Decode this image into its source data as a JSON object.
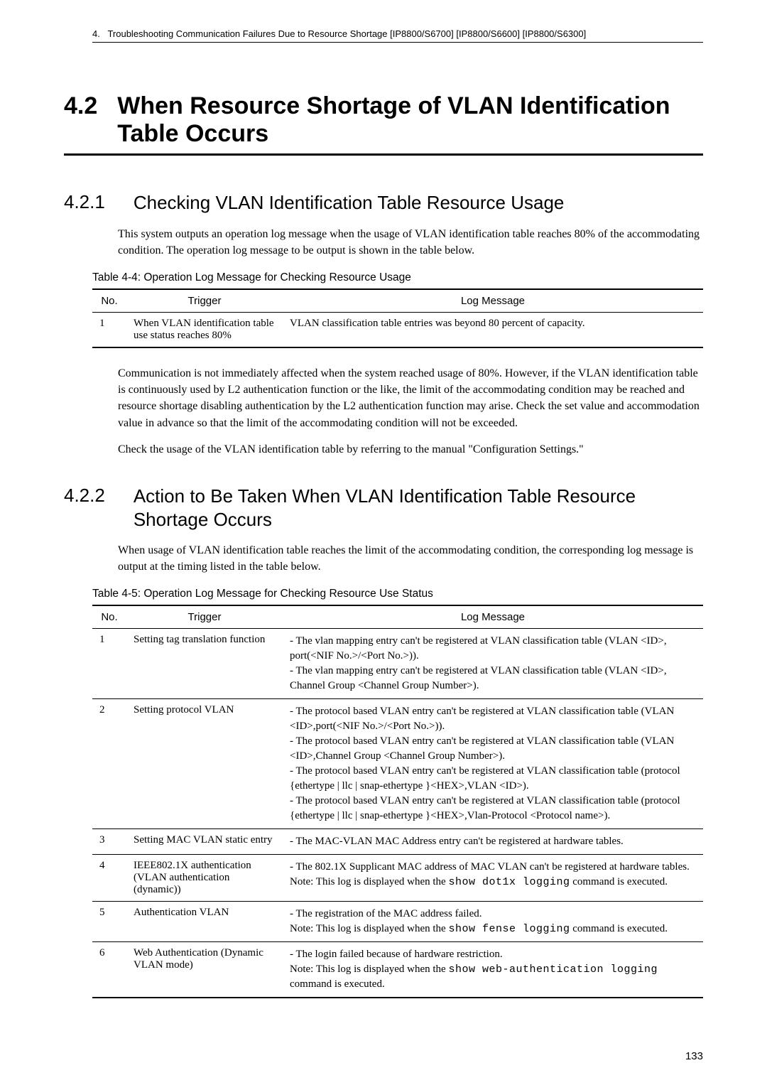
{
  "header": {
    "chapter_num": "4.",
    "chapter_title": "Troubleshooting Communication Failures Due to Resource Shortage [IP8800/S6700] [IP8800/S6600] [IP8800/S6300]"
  },
  "section": {
    "num": "4.2",
    "title": "When Resource Shortage of VLAN Identification Table Occurs"
  },
  "sub1": {
    "num": "4.2.1",
    "title": "Checking VLAN Identification Table Resource Usage",
    "para1": "This system outputs an operation log message when the usage of VLAN identification table reaches 80% of the accommodating condition. The operation log message to be output is shown in the table below.",
    "para2": "Communication is not immediately affected when the system reached usage of 80%. However, if the VLAN identification table is continuously used by L2 authentication function or the like, the limit of the accommodating condition may be reached and resource shortage disabling authentication by the L2 authentication function may arise. Check the set value and accommodation value in advance so that the limit of the accommodating condition will not be exceeded.",
    "para3": "Check the usage of the VLAN identification table by referring to the manual \"Configuration Settings.\""
  },
  "table44": {
    "caption": "Table 4-4: Operation Log Message for Checking Resource Usage",
    "headers": {
      "no": "No.",
      "trigger": "Trigger",
      "log": "Log Message"
    },
    "rows": [
      {
        "no": "1",
        "trigger": "When VLAN identification table use status reaches 80%",
        "log": "VLAN classification table entries was beyond 80 percent of capacity."
      }
    ]
  },
  "sub2": {
    "num": "4.2.2",
    "title": "Action to Be Taken When VLAN Identification Table Resource Shortage Occurs",
    "para1": "When usage of VLAN identification table reaches the limit of the accommodating condition, the corresponding log message is output at the timing listed in the table below."
  },
  "table45": {
    "caption": "Table 4-5: Operation Log Message for Checking Resource Use Status",
    "headers": {
      "no": "No.",
      "trigger": "Trigger",
      "log": "Log Message"
    },
    "rows": [
      {
        "no": "1",
        "trigger": "Setting tag translation function",
        "log_lines": [
          "- The vlan mapping entry can't be registered at VLAN classification table (VLAN <ID>, port(<NIF No.>/<Port No.>)).",
          "- The vlan mapping entry can't be registered at VLAN classification table (VLAN <ID>, Channel Group <Channel Group Number>)."
        ]
      },
      {
        "no": "2",
        "trigger": "Setting protocol VLAN",
        "log_lines": [
          "- The protocol based VLAN entry can't be registered at VLAN classification table (VLAN <ID>,port(<NIF No.>/<Port No.>)).",
          "- The protocol based VLAN entry can't be registered at VLAN classification table (VLAN <ID>,Channel Group <Channel Group Number>).",
          "- The protocol based VLAN entry can't be registered at VLAN classification table (protocol {ethertype | llc | snap-ethertype }<HEX>,VLAN <ID>).",
          "- The protocol based VLAN entry can't be registered at VLAN classification table (protocol {ethertype | llc | snap-ethertype }<HEX>,Vlan-Protocol <Protocol name>)."
        ]
      },
      {
        "no": "3",
        "trigger": "Setting MAC VLAN static entry",
        "log_lines": [
          "- The MAC-VLAN MAC Address entry can't be registered at hardware tables."
        ]
      },
      {
        "no": "4",
        "trigger": "IEEE802.1X authentication (VLAN authentication (dynamic))",
        "log_pre": "- The 802.1X Supplicant MAC address of MAC VLAN can't be registered at hardware tables.",
        "note_prefix": "Note: This log is displayed when the ",
        "note_cmd": "show dot1x logging",
        "note_suffix": " command is executed."
      },
      {
        "no": "5",
        "trigger": "Authentication VLAN",
        "log_pre": "- The registration of the MAC address failed.",
        "note_prefix": "Note: This log is displayed when the ",
        "note_cmd": "show fense logging",
        "note_suffix": " command is executed."
      },
      {
        "no": "6",
        "trigger": "Web Authentication (Dynamic VLAN mode)",
        "log_pre": "- The login failed because of hardware restriction.",
        "note_prefix": "Note: This log is displayed when the ",
        "note_cmd": "show web-authentication logging",
        "note_suffix": " command is executed."
      }
    ]
  },
  "page_number": "133"
}
